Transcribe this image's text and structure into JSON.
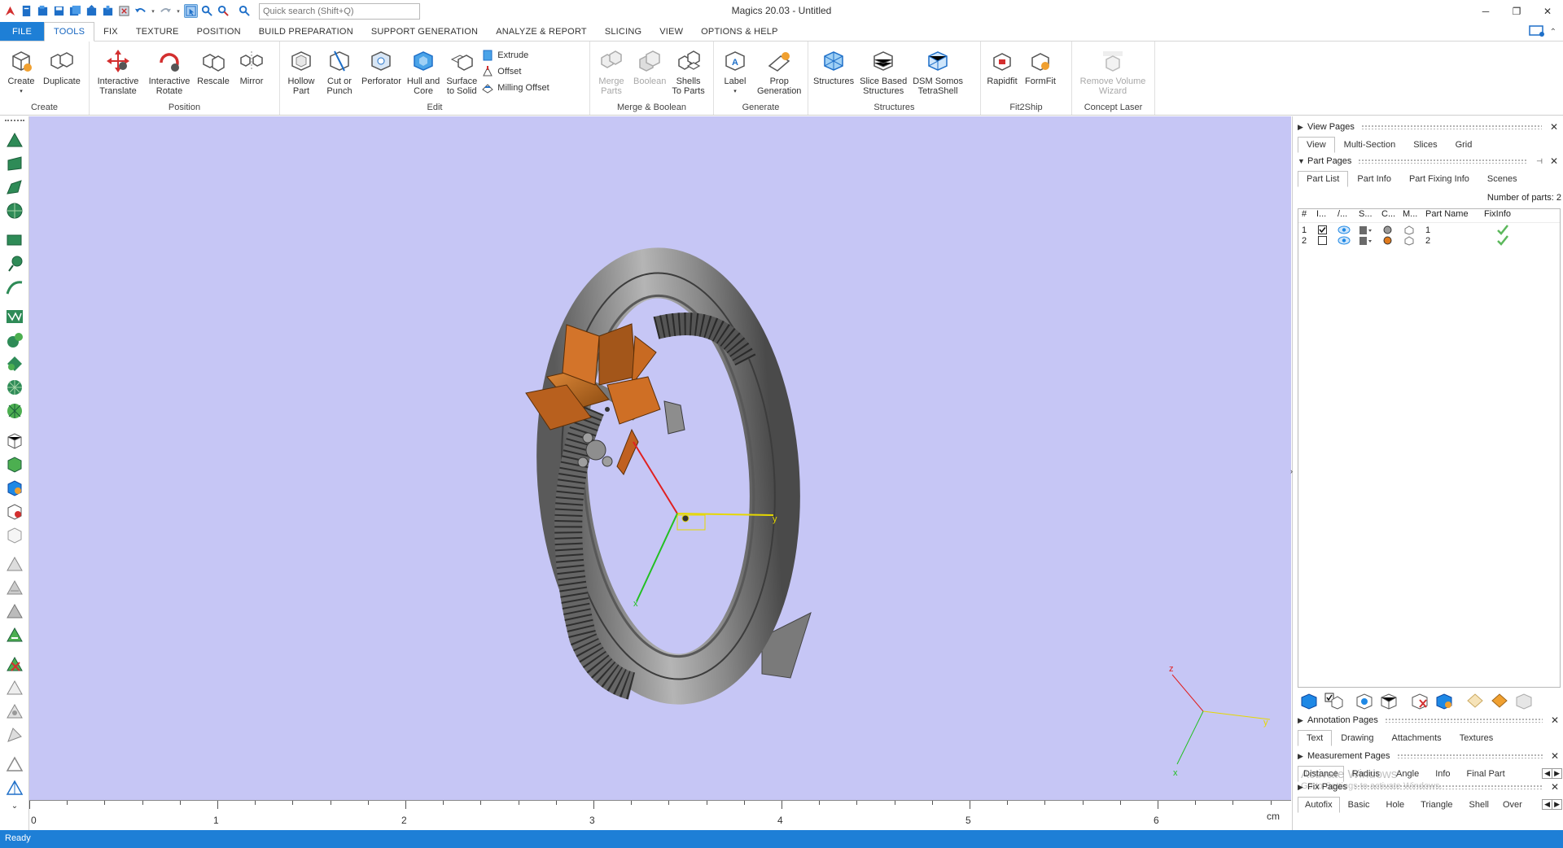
{
  "app": {
    "title": "Magics 20.03 - Untitled",
    "search_placeholder": "Quick search (Shift+Q)",
    "window_controls": [
      "─",
      "❐",
      "✕"
    ]
  },
  "menu": {
    "tabs": [
      "FILE",
      "TOOLS",
      "FIX",
      "TEXTURE",
      "POSITION",
      "BUILD PREPARATION",
      "SUPPORT GENERATION",
      "ANALYZE & REPORT",
      "SLICING",
      "VIEW",
      "OPTIONS & HELP"
    ],
    "active_tab": "TOOLS"
  },
  "ribbon": {
    "groups": [
      {
        "label": "Create",
        "buttons": [
          {
            "label": "Create",
            "icon": "cube-create-icon",
            "dropdown": true
          },
          {
            "label": "Duplicate",
            "icon": "duplicate-icon"
          }
        ]
      },
      {
        "label": "Position",
        "buttons": [
          {
            "label": "Interactive\nTranslate",
            "icon": "translate-icon",
            "dropdown": true
          },
          {
            "label": "Interactive\nRotate",
            "icon": "rotate-icon",
            "dropdown": true
          },
          {
            "label": "Rescale",
            "icon": "rescale-icon"
          },
          {
            "label": "Mirror",
            "icon": "mirror-icon"
          }
        ]
      },
      {
        "label": "Edit",
        "buttons": [
          {
            "label": "Hollow\nPart",
            "icon": "hollow-icon"
          },
          {
            "label": "Cut or\nPunch",
            "icon": "cut-icon"
          },
          {
            "label": "Perforator",
            "icon": "perforator-icon"
          },
          {
            "label": "Hull and\nCore",
            "icon": "hull-icon"
          },
          {
            "label": "Surface\nto Solid",
            "icon": "surface-icon"
          }
        ],
        "small": [
          "Extrude",
          "Offset",
          "Milling Offset"
        ]
      },
      {
        "label": "Merge & Boolean",
        "buttons": [
          {
            "label": "Merge\nParts",
            "icon": "merge-icon",
            "disabled": true
          },
          {
            "label": "Boolean",
            "icon": "boolean-icon",
            "disabled": true
          },
          {
            "label": "Shells\nTo Parts",
            "icon": "shells-icon"
          }
        ]
      },
      {
        "label": "Generate",
        "buttons": [
          {
            "label": "Label",
            "icon": "label-icon",
            "dropdown": true
          },
          {
            "label": "Prop\nGeneration",
            "icon": "prop-icon"
          }
        ]
      },
      {
        "label": "Structures",
        "buttons": [
          {
            "label": "Structures",
            "icon": "structures-icon"
          },
          {
            "label": "Slice Based\nStructures",
            "icon": "slice-structures-icon"
          },
          {
            "label": "DSM Somos\nTetraShell",
            "icon": "tetrashell-icon"
          }
        ]
      },
      {
        "label": "Fit2Ship",
        "buttons": [
          {
            "label": "Rapidfit",
            "icon": "rapidfit-icon"
          },
          {
            "label": "FormFit",
            "icon": "formfit-icon"
          }
        ]
      },
      {
        "label": "Concept Laser",
        "buttons": [
          {
            "label": "Remove Volume\nWizard",
            "icon": "concept-laser-icon",
            "disabled": true
          }
        ]
      }
    ]
  },
  "viewport": {
    "background": "#c6c6f5",
    "gizmo": {
      "x_label": "x",
      "y_label": "y",
      "z_label": "z"
    },
    "watermark_line1": "Activate Windows",
    "watermark_line2": "Go to Settings to activate Windows."
  },
  "ruler": {
    "labels": [
      "0",
      "1",
      "2",
      "3",
      "4",
      "5",
      "6"
    ],
    "unit": "cm"
  },
  "right_panel": {
    "view_pages": {
      "title": "View Pages",
      "tabs": [
        "View",
        "Multi-Section",
        "Slices",
        "Grid"
      ],
      "active": "View"
    },
    "part_pages": {
      "title": "Part Pages",
      "tabs": [
        "Part List",
        "Part Info",
        "Part Fixing Info",
        "Scenes"
      ],
      "active": "Part List",
      "parts_count_label": "Number of parts: 2",
      "columns": [
        "#",
        "I...",
        "/...",
        "S...",
        "C...",
        "M...",
        "Part Name",
        "FixInfo"
      ],
      "rows": [
        {
          "index": "1",
          "selected": true,
          "visible": true,
          "color": "#9a9a9a",
          "name": "1",
          "fixed": true
        },
        {
          "index": "2",
          "selected": false,
          "visible": true,
          "color": "#e07a1c",
          "name": "2",
          "fixed": true
        }
      ]
    },
    "annotation_pages": {
      "title": "Annotation Pages",
      "tabs": [
        "Text",
        "Drawing",
        "Attachments",
        "Textures"
      ],
      "active": "Text"
    },
    "measurement_pages": {
      "title": "Measurement Pages",
      "tabs": [
        "Distance",
        "Radius",
        "Angle",
        "Info",
        "Final Part"
      ],
      "active": "Distance"
    },
    "fix_pages": {
      "title": "Fix Pages",
      "tabs": [
        "Autofix",
        "Basic",
        "Hole",
        "Triangle",
        "Shell",
        "Over"
      ],
      "active": "Autofix"
    }
  },
  "status": {
    "text": "Ready"
  }
}
